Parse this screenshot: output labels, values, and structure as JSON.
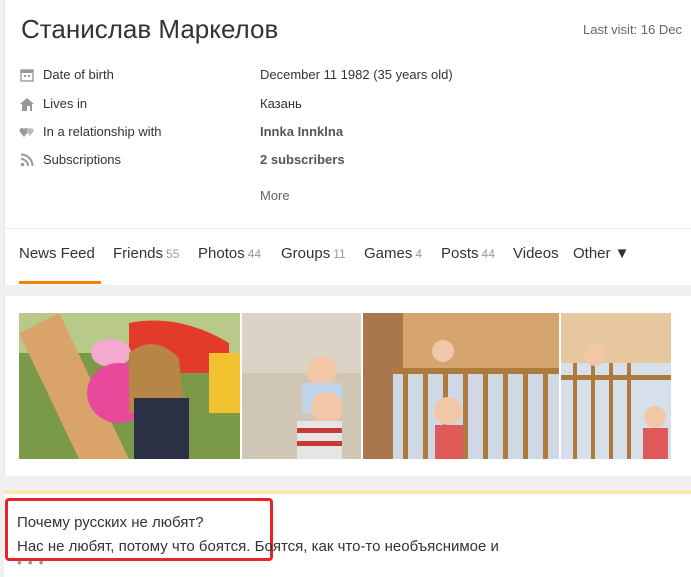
{
  "profile": {
    "name": "Станислав Маркелов",
    "last_visit_label": "Last visit:",
    "last_visit_value": "16 Dec",
    "info": [
      {
        "label": "Date of birth",
        "value": "December 11 1982 (35 years old)",
        "icon": "calendar-icon"
      },
      {
        "label": "Lives in",
        "value": "Казань",
        "icon": "home-icon"
      },
      {
        "label": "In a relationship with",
        "value": "Innka Innklna",
        "icon": "hearts-icon"
      },
      {
        "label": "Subscriptions",
        "value": "2 subscribers",
        "icon": "rss-icon"
      }
    ],
    "more_label": "More"
  },
  "tabs": [
    {
      "label": "News Feed",
      "count": ""
    },
    {
      "label": "Friends",
      "count": "55"
    },
    {
      "label": "Photos",
      "count": "44"
    },
    {
      "label": "Groups",
      "count": "11"
    },
    {
      "label": "Games",
      "count": "4"
    },
    {
      "label": "Posts",
      "count": "44"
    },
    {
      "label": "Videos",
      "count": ""
    },
    {
      "label": "Other ▼",
      "count": ""
    }
  ],
  "post": {
    "title": "Почему русских не любят?",
    "body": "Нас не любят, потому что боятся. Боятся, как что-то необъяснимое и",
    "ellipsis": "• • •"
  },
  "colors": {
    "accent": "#ee8208",
    "highlight": "#e8232b",
    "post_border": "#fbe6b4"
  }
}
